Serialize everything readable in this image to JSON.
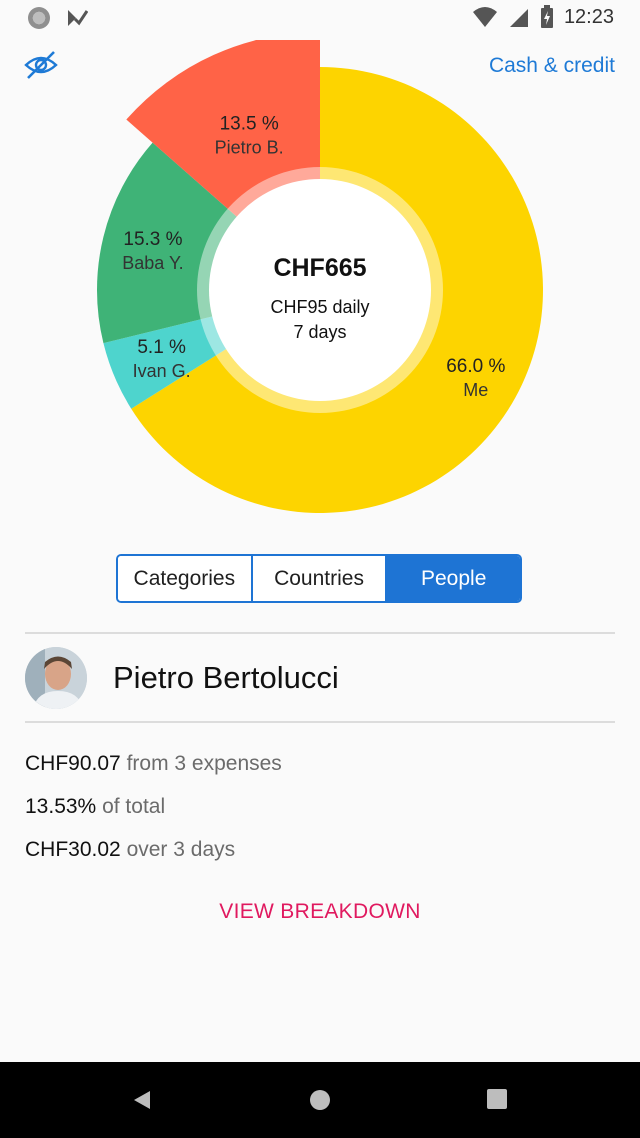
{
  "status_bar": {
    "time": "12:23"
  },
  "header": {
    "toggle_label": "Cash & credit"
  },
  "summary": {
    "total": "CHF665",
    "daily": "CHF95 daily",
    "days": "7 days"
  },
  "chart_data": {
    "type": "pie",
    "style": "donut",
    "start_at": "top, clockwise",
    "slices": [
      {
        "name": "Me",
        "pct_label": "66.0 %",
        "value": 66.0,
        "color": "#fdd400"
      },
      {
        "name": "Ivan G.",
        "pct_label": "5.1 %",
        "value": 5.1,
        "color": "#4ed4cd"
      },
      {
        "name": "Baba Y.",
        "pct_label": "15.3 %",
        "value": 15.3,
        "color": "#3fb377"
      },
      {
        "name": "Pietro B.",
        "pct_label": "13.5 %",
        "value": 13.5,
        "color": "#ff6347",
        "selected": true
      }
    ]
  },
  "tabs": {
    "categories": "Categories",
    "countries": "Countries",
    "people": "People"
  },
  "person": {
    "name": "Pietro Bertolucci"
  },
  "stats": {
    "amount": "CHF90.07",
    "amount_suffix": "from 3 expenses",
    "share": "13.53%",
    "share_suffix": "of total",
    "per_day": "CHF30.02",
    "per_day_suffix": "over 3 days"
  },
  "action": {
    "label": "VIEW BREAKDOWN"
  },
  "colors": {
    "accent": "#1e74d4",
    "action": "#e0195f"
  }
}
